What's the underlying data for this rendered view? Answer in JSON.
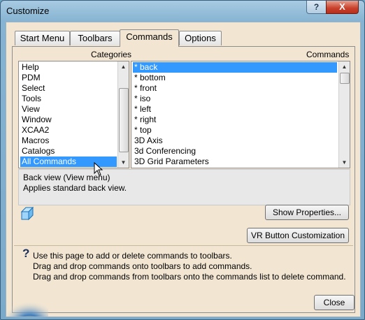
{
  "window": {
    "title": "Customize",
    "help_glyph": "?",
    "close_glyph": "X"
  },
  "tabs": [
    {
      "label": "Start Menu",
      "active": false
    },
    {
      "label": "Toolbars",
      "active": false
    },
    {
      "label": "Commands",
      "active": true
    },
    {
      "label": "Options",
      "active": false
    }
  ],
  "categories": {
    "header": "Categories",
    "items": [
      "Help",
      "PDM",
      "Select",
      "Tools",
      "View",
      "Window",
      "XCAA2",
      "Macros",
      "Catalogs",
      "All Commands"
    ],
    "selected": "All Commands"
  },
  "commands": {
    "header": "Commands",
    "items": [
      "* back",
      "* bottom",
      "* front",
      "* iso",
      "* left",
      "* right",
      "* top",
      "3D Axis",
      "3d Conferencing",
      "3D Grid Parameters"
    ],
    "selected": "* back"
  },
  "description": {
    "line1": "Back view (View menu)",
    "line2": "Applies standard back view."
  },
  "buttons": {
    "show_properties": "Show Properties...",
    "vr_customization": "VR Button Customization",
    "close": "Close"
  },
  "tip": {
    "icon_glyph": "?",
    "line1": "Use this page to add or delete commands to toolbars.",
    "line2": "Drag and drop commands onto toolbars to add commands.",
    "line3": "Drag and drop commands from toolbars onto the commands list to delete command."
  },
  "icons": {
    "command_icon": "3d-cube-icon"
  }
}
